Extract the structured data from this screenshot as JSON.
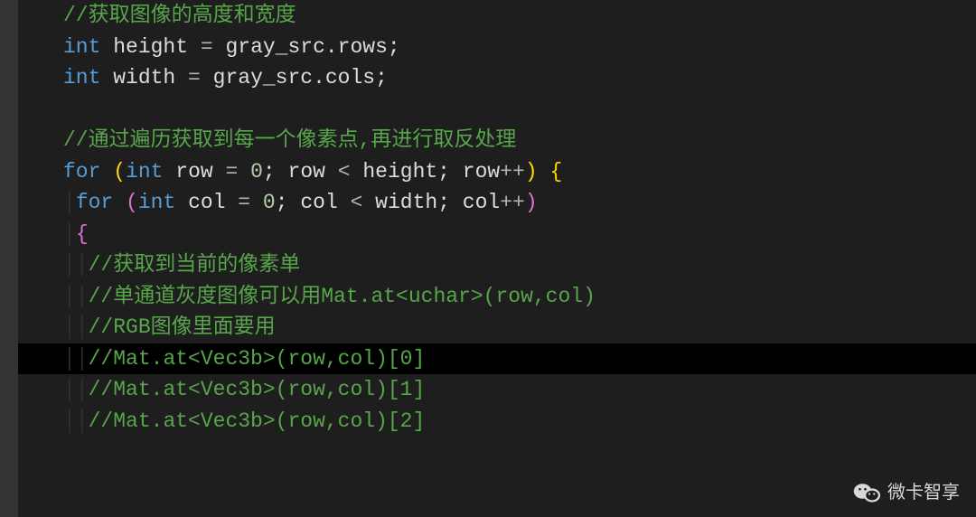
{
  "lines": {
    "l1_comment": "//获取图像的高度和宽度",
    "l2_int": "int",
    "l2_height": " height ",
    "l2_eq": "=",
    "l2_expr": " gray_src.rows;",
    "l3_int": "int",
    "l3_width": " width ",
    "l3_eq": "=",
    "l3_expr": " gray_src.cols;",
    "l5_comment": "//通过遍历获取到每一个像素点,再进行取反处理",
    "l6_for": "for",
    "l6_sp1": " ",
    "l6_op": "(",
    "l6_int": "int",
    "l6_row": " row ",
    "l6_eq": "=",
    "l6_sp2": " ",
    "l6_zero": "0",
    "l6_semi": "; row ",
    "l6_lt": "<",
    "l6_height": " height; row",
    "l6_pp": "++",
    "l6_cp": ")",
    "l6_sp3": " ",
    "l6_brace": "{",
    "l7_for": "for",
    "l7_sp1": " ",
    "l7_op": "(",
    "l7_int": "int",
    "l7_col": " col ",
    "l7_eq": "=",
    "l7_sp2": " ",
    "l7_zero": "0",
    "l7_semi": "; col ",
    "l7_lt": "<",
    "l7_width": " width; col",
    "l7_pp": "++",
    "l7_cp": ")",
    "l8_brace": "{",
    "l9_comment": "//获取到当前的像素单",
    "l10_comment": "//单通道灰度图像可以用Mat.at<uchar>(row,col)",
    "l11_comment": "//RGB图像里面要用",
    "l12_comment": "//Mat.at<Vec3b>(row,col)[0]",
    "l13_comment": "//Mat.at<Vec3b>(row,col)[1]",
    "l14_comment": "//Mat.at<Vec3b>(row,col)[2]"
  },
  "watermark": {
    "text": "微卡智享"
  },
  "colors": {
    "background": "#1e1e1e",
    "comment": "#57a64a",
    "keyword": "#569cd6",
    "identifier": "#dcdcdc",
    "number": "#b5cea8"
  }
}
